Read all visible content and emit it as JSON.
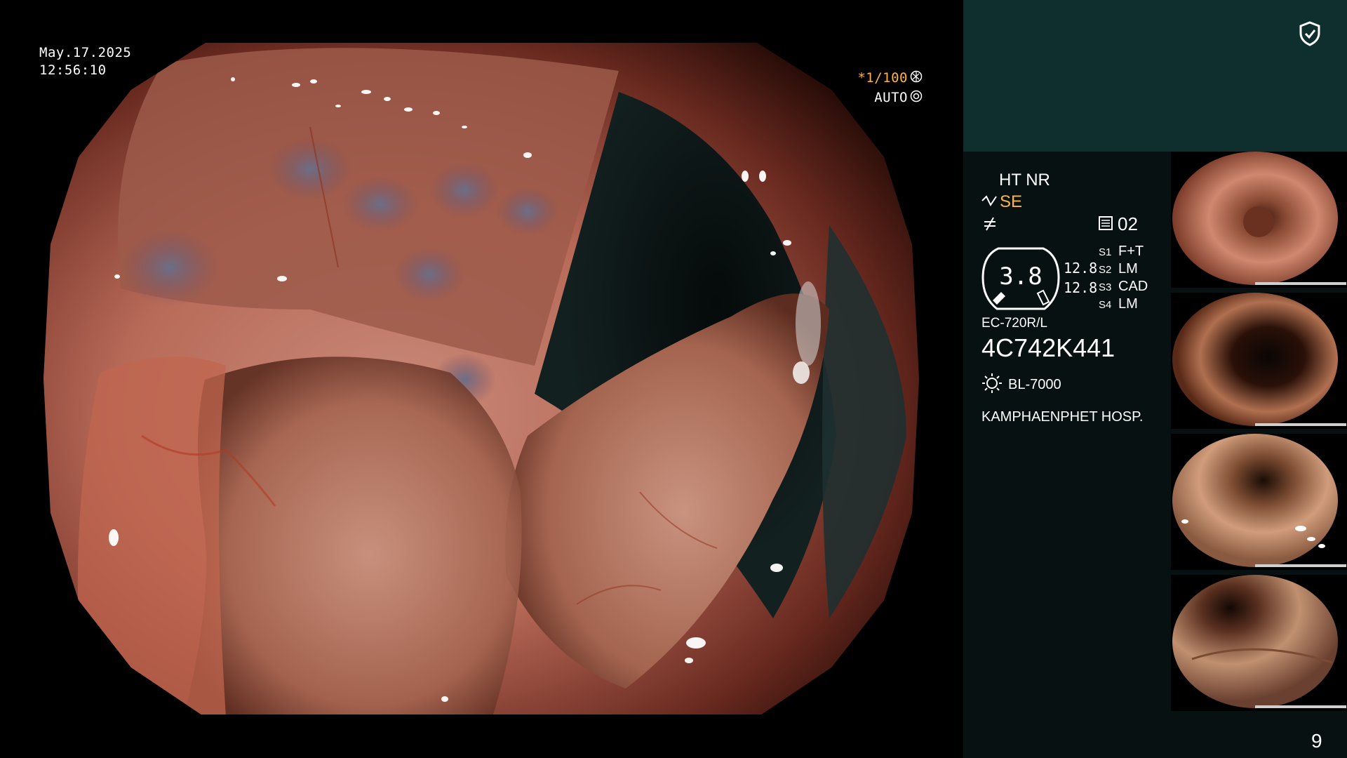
{
  "overlay": {
    "date": "May.17.2025",
    "time": "12:56:10",
    "shutter": "*1/100",
    "iris": "AUTO"
  },
  "panel": {
    "ht_nr": "HT NR",
    "se": "SE",
    "mem_value": "02",
    "gauge_value": "3.8",
    "gauge_side_1": "12.8",
    "gauge_side_2": "12.8",
    "s_labels": [
      "S1",
      "S2",
      "S3",
      "S4"
    ],
    "s_values": [
      "F+T",
      "LM",
      "CAD",
      "LM"
    ],
    "scope_model": "EC-720R/L",
    "serial": "4C742K441",
    "light_source": "BL-7000",
    "hospital": "KAMPHAENPHET HOSP.",
    "page_number": "9"
  },
  "colors": {
    "accent_orange": "#ffb347",
    "panel_bg": "#071111",
    "panel_top_bg": "#0f2e2e"
  },
  "icons": [
    "shield-check-icon",
    "shutter-icon",
    "iris-icon",
    "structure-enhance-icon",
    "freeze-icon",
    "memory-icon",
    "light-source-icon"
  ]
}
